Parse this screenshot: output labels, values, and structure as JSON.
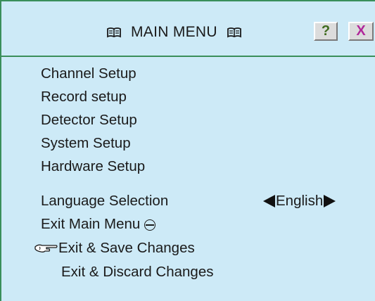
{
  "window": {
    "title": "MAIN MENU",
    "title_icon": "book-icon",
    "help_label": "?",
    "close_label": "X"
  },
  "menu": {
    "items": [
      {
        "label": "Channel Setup"
      },
      {
        "label": "Record setup"
      },
      {
        "label": "Detector Setup"
      },
      {
        "label": "System Setup"
      },
      {
        "label": "Hardware Setup"
      },
      {
        "label": "Language Selection"
      },
      {
        "label": "Exit Main Menu"
      },
      {
        "label": "Exit & Save Changes"
      },
      {
        "label": "Exit & Discard Changes"
      }
    ],
    "language_value": "English",
    "selected_item": "Exit & Save Changes"
  },
  "colors": {
    "background": "#cdeaf7",
    "border": "#3a8f5a",
    "help_text": "#3f6b1e",
    "close_text": "#b0289a"
  }
}
